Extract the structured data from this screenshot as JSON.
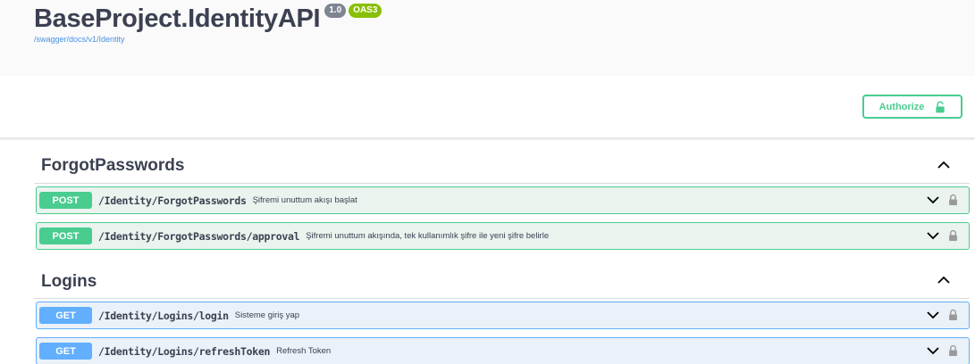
{
  "info": {
    "title": "BaseProject.IdentityAPI",
    "version": "1.0",
    "oas": "OAS3",
    "url": "/swagger/docs/v1/Identity"
  },
  "scheme": {
    "authorize_label": "Authorize"
  },
  "colors": {
    "post": "#49cc90",
    "get": "#61affe",
    "text": "#3b4151",
    "link": "#4990e2"
  },
  "tags": [
    {
      "name": "ForgotPasswords",
      "operations": [
        {
          "method": "POST",
          "path": "/Identity/ForgotPasswords",
          "summary": "Şifremi unuttum akışı başlat"
        },
        {
          "method": "POST",
          "path": "/Identity/ForgotPasswords/approval",
          "summary": "Şifremi unuttum akışında, tek kullanımlık şifre ile yeni şifre belirle"
        }
      ]
    },
    {
      "name": "Logins",
      "operations": [
        {
          "method": "GET",
          "path": "/Identity/Logins/login",
          "summary": "Sisteme giriş yap"
        },
        {
          "method": "GET",
          "path": "/Identity/Logins/refreshToken",
          "summary": "Refresh Token"
        }
      ]
    }
  ]
}
